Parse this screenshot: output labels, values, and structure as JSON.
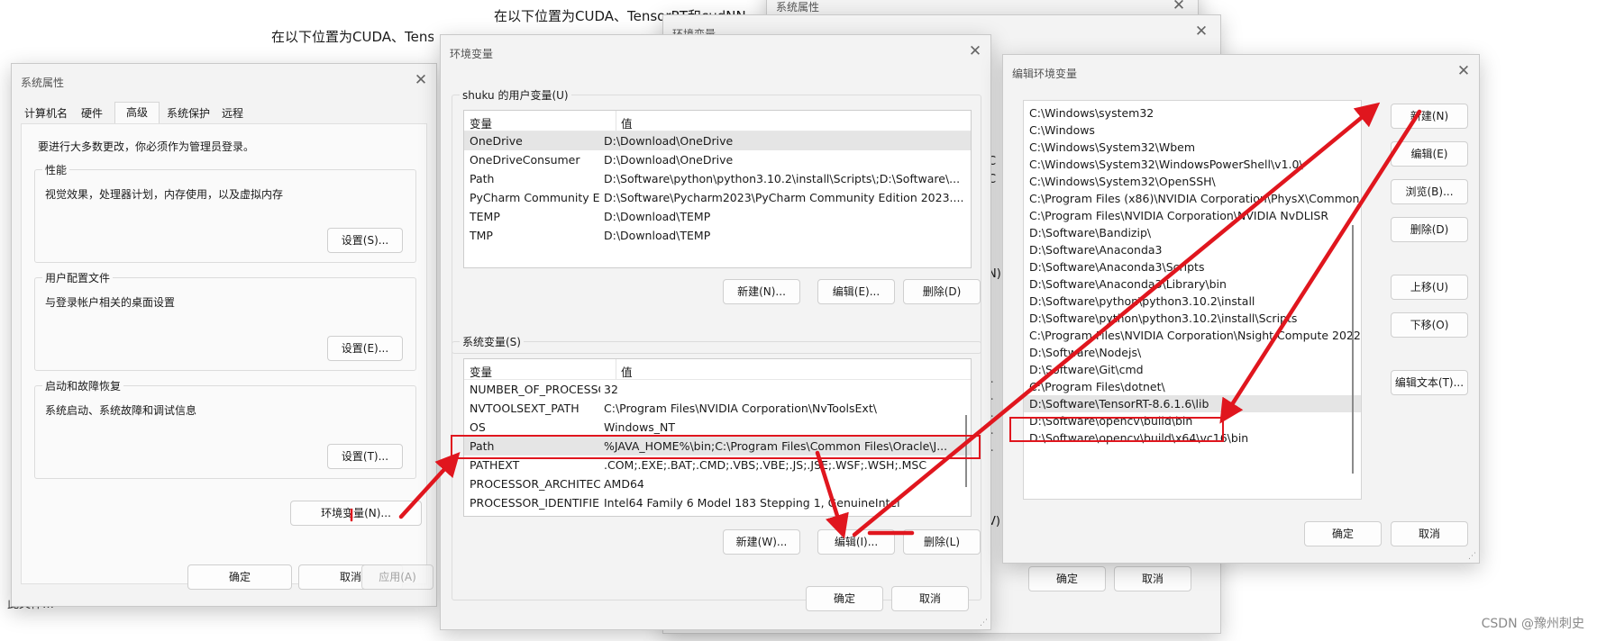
{
  "bg_texts": {
    "top_caption": "在以下位置为CUDA、TensorRT和cudNN",
    "top_caption_2": "在以下位置为CUDA、TensorRT和cudNN",
    "bottom_left": "此文件…"
  },
  "bg_windows": {
    "sys_props_title": "系统属性",
    "env_vars_title": "环境变量",
    "ok": "确定",
    "cancel": "取消",
    "fragments": [
      "C",
      "C",
      "N)",
      "r",
      "r",
      "r",
      "r",
      "r",
      "V)"
    ]
  },
  "system_properties": {
    "title": "系统属性",
    "tabs": [
      "计算机名",
      "硬件",
      "高级",
      "系统保护",
      "远程"
    ],
    "active_tab": "高级",
    "admin_note": "要进行大多数更改，你必须作为管理员登录。",
    "performance": {
      "label": "性能",
      "desc": "视觉效果，处理器计划，内存使用，以及虚拟内存",
      "button": "设置(S)..."
    },
    "user_profiles": {
      "label": "用户配置文件",
      "desc": "与登录帐户相关的桌面设置",
      "button": "设置(E)..."
    },
    "startup": {
      "label": "启动和故障恢复",
      "desc": "系统启动、系统故障和调试信息",
      "button": "设置(T)..."
    },
    "env_button": "环境变量(N)...",
    "ok": "确定",
    "cancel": "取消",
    "apply": "应用(A)"
  },
  "environment_variables": {
    "title": "环境变量",
    "user_section": "shuku 的用户变量(U)",
    "col_var": "变量",
    "col_value": "值",
    "user_vars": [
      {
        "name": "OneDrive",
        "value": "D:\\Download\\OneDrive"
      },
      {
        "name": "OneDriveConsumer",
        "value": "D:\\Download\\OneDrive"
      },
      {
        "name": "Path",
        "value": "D:\\Software\\python\\python3.10.2\\install\\Scripts\\;D:\\Software\\..."
      },
      {
        "name": "PyCharm Community Editi...",
        "value": "D:\\Software\\Pycharm2023\\PyCharm Community Edition 2023...."
      },
      {
        "name": "TEMP",
        "value": "D:\\Download\\TEMP"
      },
      {
        "name": "TMP",
        "value": "D:\\Download\\TEMP"
      }
    ],
    "user_buttons": {
      "new": "新建(N)...",
      "edit": "编辑(E)...",
      "delete": "删除(D)"
    },
    "system_section": "系统变量(S)",
    "system_vars": [
      {
        "name": "NUMBER_OF_PROCESSORS",
        "value": "32"
      },
      {
        "name": "NVTOOLSEXT_PATH",
        "value": "C:\\Program Files\\NVIDIA Corporation\\NvToolsExt\\"
      },
      {
        "name": "OS",
        "value": "Windows_NT"
      },
      {
        "name": "Path",
        "value": "%JAVA_HOME%\\bin;C:\\Program Files\\Common Files\\Oracle\\J..."
      },
      {
        "name": "PATHEXT",
        "value": ".COM;.EXE;.BAT;.CMD;.VBS;.VBE;.JS;.JSE;.WSF;.WSH;.MSC"
      },
      {
        "name": "PROCESSOR_ARCHITECT...",
        "value": "AMD64"
      },
      {
        "name": "PROCESSOR_IDENTIFIER",
        "value": "Intel64 Family 6 Model 183 Stepping 1, GenuineIntel"
      }
    ],
    "system_buttons": {
      "new": "新建(W)...",
      "edit": "编辑(I)...",
      "delete": "删除(L)"
    },
    "ok": "确定",
    "cancel": "取消"
  },
  "edit_env": {
    "title": "编辑环境变量",
    "paths": [
      "C:\\Windows\\system32",
      "C:\\Windows",
      "C:\\Windows\\System32\\Wbem",
      "C:\\Windows\\System32\\WindowsPowerShell\\v1.0\\",
      "C:\\Windows\\System32\\OpenSSH\\",
      "C:\\Program Files (x86)\\NVIDIA Corporation\\PhysX\\Common",
      "C:\\Program Files\\NVIDIA Corporation\\NVIDIA NvDLISR",
      "D:\\Software\\Bandizip\\",
      "D:\\Software\\Anaconda3",
      "D:\\Software\\Anaconda3\\Scripts",
      "D:\\Software\\Anaconda3\\Library\\bin",
      "D:\\Software\\python\\python3.10.2\\install",
      "D:\\Software\\python\\python3.10.2\\install\\Scripts",
      "C:\\Program Files\\NVIDIA Corporation\\Nsight Compute 2022....",
      "D:\\Software\\Nodejs\\",
      "D:\\Software\\Git\\cmd",
      "C:\\Program Files\\dotnet\\",
      "D:\\Software\\TensorRT-8.6.1.6\\lib",
      "D:\\Software\\opencv\\build\\bin",
      "D:\\Software\\opencv\\build\\x64\\vc16\\bin"
    ],
    "buttons": {
      "new": "新建(N)",
      "edit": "编辑(E)",
      "browse": "浏览(B)...",
      "delete": "删除(D)",
      "up": "上移(U)",
      "down": "下移(O)",
      "edit_text": "编辑文本(T)..."
    },
    "ok": "确定",
    "cancel": "取消"
  },
  "watermark": "CSDN @豫州刺史",
  "colors": {
    "annotation_red": "#e0161e",
    "selection": "#e5e5e5"
  }
}
